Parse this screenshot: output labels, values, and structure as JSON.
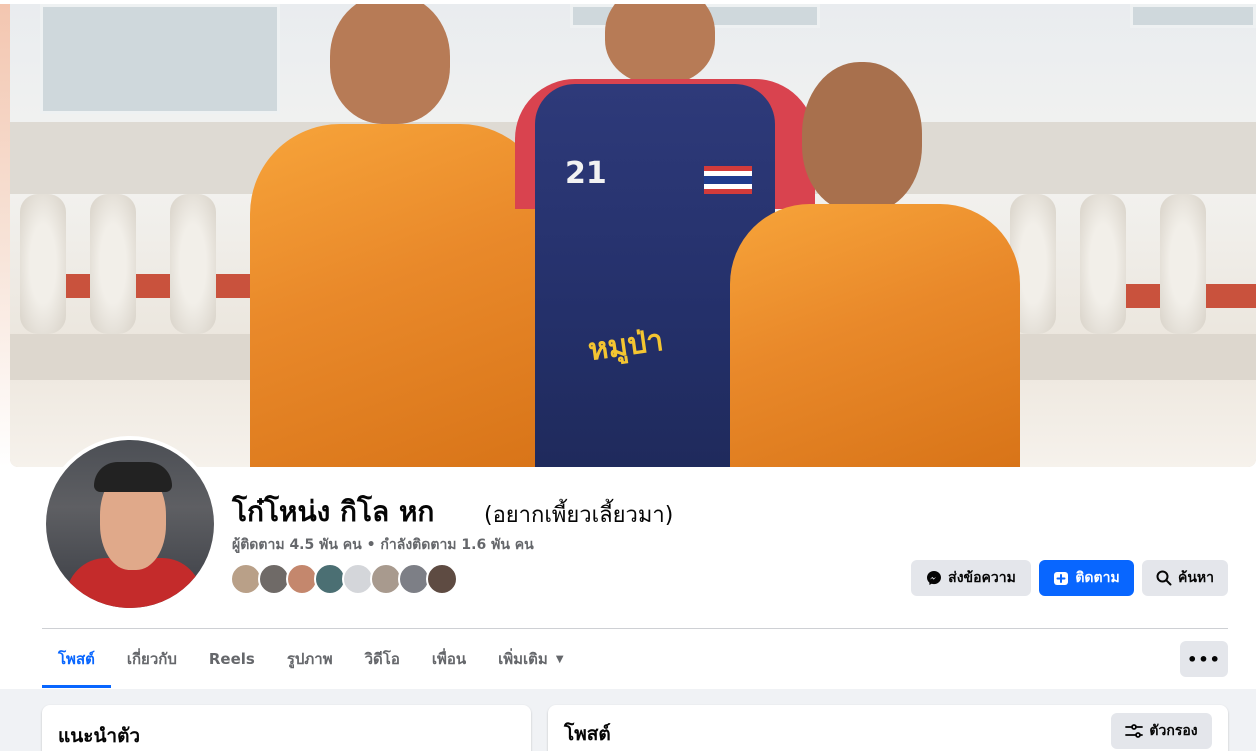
{
  "profile": {
    "name": "โก๋โหน่ง กิโล หก",
    "alternate_name": "(อยากเพี้ยวเลี้ยวมา)",
    "stats": "ผู้ติดตาม 4.5 พัน คน • กำลังติดตาม 1.6 พัน คน",
    "jersey_number": "21",
    "jersey_text": "หมูป่า"
  },
  "actions": {
    "message_label": "ส่งข้อความ",
    "follow_label": "ติดตาม",
    "search_label": "ค้นหา"
  },
  "tabs": [
    {
      "label": "โพสต์",
      "active": true
    },
    {
      "label": "เกี่ยวกับ",
      "active": false
    },
    {
      "label": "Reels",
      "active": false
    },
    {
      "label": "รูปภาพ",
      "active": false
    },
    {
      "label": "วิดีโอ",
      "active": false
    },
    {
      "label": "เพื่อน",
      "active": false
    },
    {
      "label": "เพิ่มเติม",
      "active": false
    }
  ],
  "more_menu_label": "•••",
  "intro_card": {
    "title": "แนะนำตัว"
  },
  "posts_card": {
    "title": "โพสต์",
    "filter_label": "ตัวกรอง"
  },
  "colors": {
    "accent": "#0866ff",
    "secondary_text": "#65676b",
    "button_gray": "#e4e6eb",
    "page_bg": "#f0f2f5"
  },
  "icons": {
    "message": "messenger-icon",
    "follow": "follow-plus-icon",
    "search": "search-icon",
    "filter": "filter-icon",
    "dropdown": "chevron-down-icon"
  }
}
